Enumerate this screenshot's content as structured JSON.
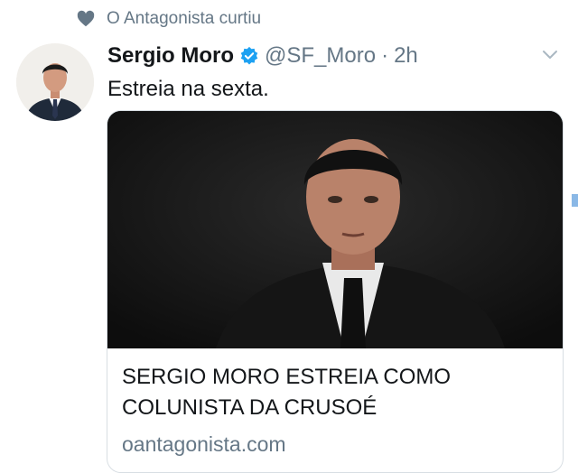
{
  "social_context": {
    "icon": "heart-icon",
    "text": "O Antagonista curtiu"
  },
  "tweet": {
    "author_name": "Sergio Moro",
    "verified": true,
    "handle": "@SF_Moro",
    "separator": "·",
    "time": "2h",
    "text": "Estreia na sexta."
  },
  "card": {
    "title": "SERGIO MORO ESTREIA COMO COLUNISTA DA CRUSOÉ",
    "domain": "oantagonista.com"
  },
  "colors": {
    "accent": "#1da1f2",
    "muted": "#657786",
    "text": "#14171a"
  }
}
